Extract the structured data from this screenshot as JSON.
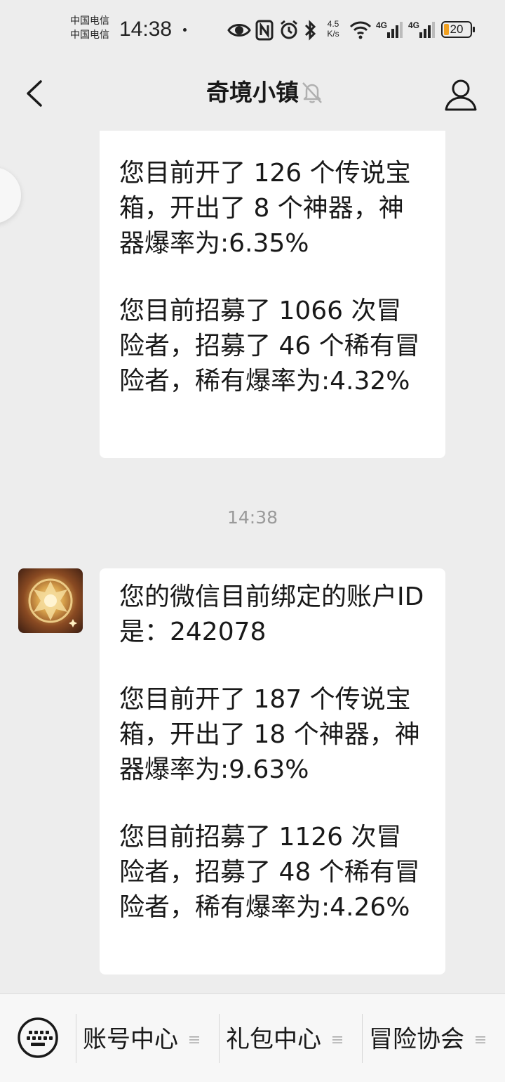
{
  "status_bar": {
    "carrier_1": "中国电信",
    "carrier_2": "中国电信",
    "time": "14:38",
    "net_speed_value": "4.5",
    "net_speed_unit": "K/s",
    "network_1": "4G",
    "network_2": "4G",
    "battery_level": "20",
    "battery_fraction": 0.2
  },
  "nav": {
    "title": "奇境小镇",
    "back_icon": "chevron-left-icon",
    "mute_icon": "bell-off-icon",
    "profile_icon": "person-icon"
  },
  "chat": {
    "message_1": {
      "paragraphs": [
        "您目前开了 126 个传说宝箱，开出了 8 个神器，神器爆率为:6.35%",
        "您目前招募了 1066 次冒险者，招募了 46 个稀有冒险者，稀有爆率为:4.32%"
      ]
    },
    "timestamp": "14:38",
    "message_2": {
      "paragraphs": [
        "您的微信目前绑定的账户ID 是：242078",
        "您目前开了 187 个传说宝箱，开出了 18 个神器，神器爆率为:9.63%",
        "您目前招募了 1126 次冒险者，招募了 48 个稀有冒险者，稀有爆率为:4.26%"
      ]
    }
  },
  "bottom_menu": {
    "keyboard_icon": "keyboard-icon",
    "items": [
      {
        "label": "账号中心"
      },
      {
        "label": "礼包中心"
      },
      {
        "label": "冒险协会"
      }
    ]
  },
  "colors": {
    "background": "#ededed",
    "bubble": "#ffffff",
    "text": "#191919",
    "timestamp": "#9a9a9a",
    "battery_fill": "#f0a020"
  }
}
